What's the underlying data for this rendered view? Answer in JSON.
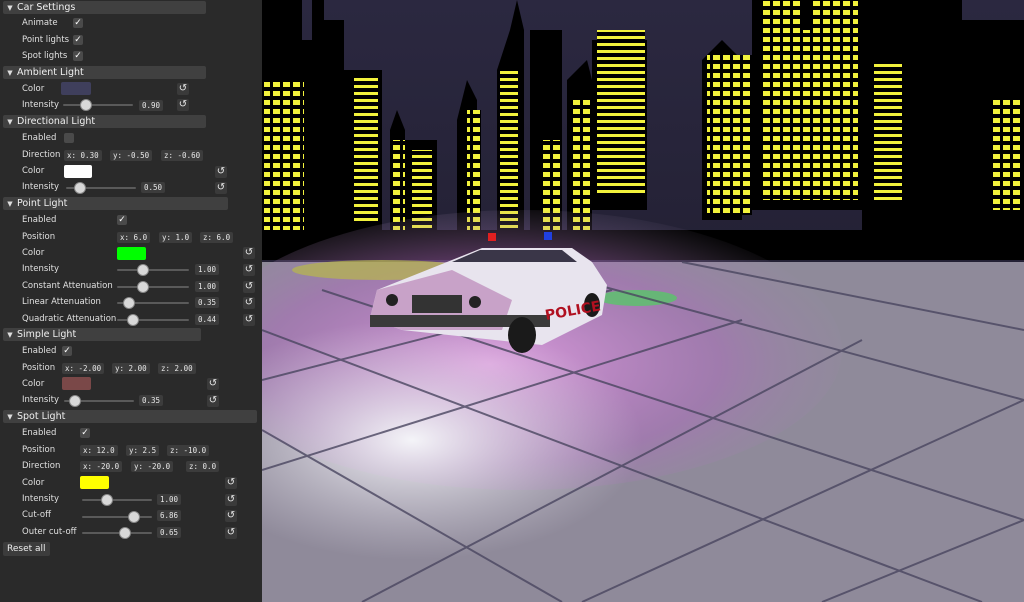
{
  "sections": {
    "car": {
      "title": "Car Settings",
      "animate": "Animate",
      "point_lights": "Point lights",
      "spot_lights": "Spot lights"
    },
    "ambient": {
      "title": "Ambient Light",
      "color_label": "Color",
      "intensity_label": "Intensity",
      "intensity": "0.90",
      "color": "#3f3f5c",
      "intensity_level": 0.45
    },
    "directional": {
      "title": "Directional Light",
      "enabled_label": "Enabled",
      "direction_label": "Direction",
      "dir_x": "x: 0.30",
      "dir_y": "y: -0.50",
      "dir_z": "z: -0.60",
      "color_label": "Color",
      "intensity_label": "Intensity",
      "intensity": "0.50",
      "color": "#ffffff",
      "intensity_level": 0.25
    },
    "point": {
      "title": "Point Light",
      "enabled_label": "Enabled",
      "position_label": "Position",
      "pos_x": "x: 6.0",
      "pos_y": "y: 1.0",
      "pos_z": "z: 6.0",
      "color_label": "Color",
      "intensity_label": "Intensity",
      "intensity": "1.00",
      "const_label": "Constant Attenuation",
      "const": "1.00",
      "linear_label": "Linear Attenuation",
      "linear": "0.35",
      "quad_label": "Quadratic Attenuation",
      "quad": "0.44",
      "color": "#00ff00"
    },
    "simple": {
      "title": "Simple Light",
      "enabled_label": "Enabled",
      "position_label": "Position",
      "pos_x": "x: -2.00",
      "pos_y": "y: 2.00",
      "pos_z": "z: 2.00",
      "color_label": "Color",
      "intensity_label": "Intensity",
      "intensity": "0.35",
      "color": "#7a4848"
    },
    "spot": {
      "title": "Spot Light",
      "enabled_label": "Enabled",
      "position_label": "Position",
      "pos_x": "x: 12.0",
      "pos_y": "y: 2.5",
      "pos_z": "z: -10.0",
      "direction_label": "Direction",
      "dir_x": "x: -20.0",
      "dir_y": "y: -20.0",
      "dir_z": "z: 0.0",
      "color_label": "Color",
      "intensity_label": "Intensity",
      "intensity": "1.00",
      "cutoff_label": "Cut-off",
      "cutoff": "6.86",
      "outer_label": "Outer cut-off",
      "outer": "0.65",
      "color": "#ffff00"
    }
  },
  "reset_all": "Reset all",
  "icons": {
    "collapse": "triangle-down-icon",
    "reset": "reset-icon",
    "check": "check-icon"
  },
  "scene": {
    "car_text": "POLICE"
  }
}
